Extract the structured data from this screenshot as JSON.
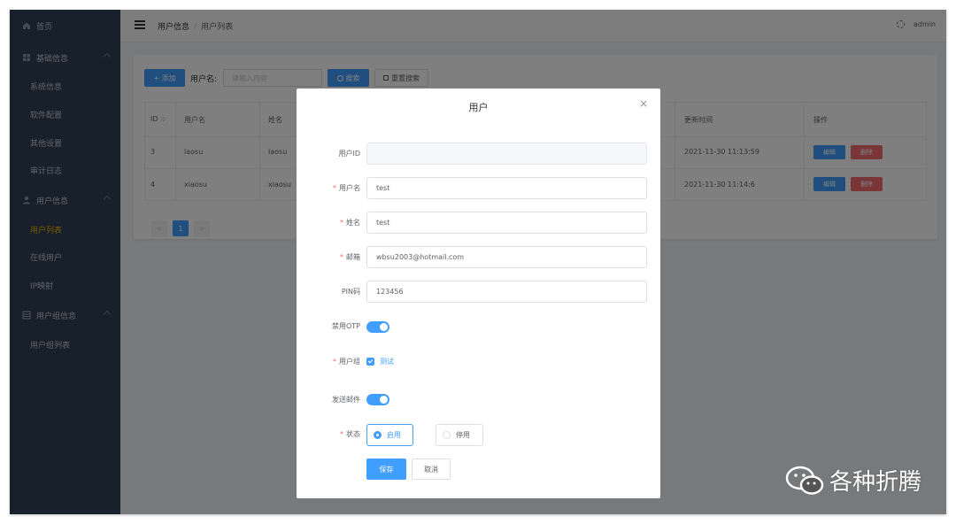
{
  "sidebar": {
    "items": [
      {
        "label": "首页",
        "level": "top",
        "icon": "home-icon"
      },
      {
        "label": "基础信息",
        "level": "top",
        "icon": "grid-icon",
        "expandable": true
      },
      {
        "label": "系统信息",
        "level": "sub"
      },
      {
        "label": "软件配置",
        "level": "sub"
      },
      {
        "label": "其他设置",
        "level": "sub"
      },
      {
        "label": "审计日志",
        "level": "sub"
      },
      {
        "label": "用户信息",
        "level": "top",
        "icon": "user-icon",
        "expandable": true
      },
      {
        "label": "用户列表",
        "level": "sub",
        "active": true
      },
      {
        "label": "在线用户",
        "level": "sub"
      },
      {
        "label": "IP映射",
        "level": "sub"
      },
      {
        "label": "用户组信息",
        "level": "top",
        "icon": "group-icon",
        "expandable": true
      },
      {
        "label": "用户组列表",
        "level": "sub"
      }
    ]
  },
  "navbar": {
    "breadcrumb": [
      "用户信息",
      "用户列表"
    ],
    "user": "admin"
  },
  "toolbar": {
    "add_label": "+ 添加",
    "filter_label": "用户名:",
    "filter_placeholder": "请输入内容",
    "search_label": "搜索",
    "reset_label": "重置搜索"
  },
  "table": {
    "headers": {
      "id": "ID",
      "username": "用户名",
      "name": "姓名",
      "updated": "更新时间",
      "ops": "操作"
    },
    "rows": [
      {
        "id": "3",
        "username": "laosu",
        "name": "laosu",
        "updated": "2021-11-30 11:13:59"
      },
      {
        "id": "4",
        "username": "xiaosu",
        "name": "xiaosu",
        "updated": "2021-11-30 11:14:6"
      }
    ],
    "edit_label": "编辑",
    "delete_label": "删除"
  },
  "pagination": {
    "current": "1",
    "prev": "<",
    "next": ">"
  },
  "dialog": {
    "title": "用户",
    "close": "×",
    "fields": {
      "user_id": {
        "label": "用户ID",
        "value": ""
      },
      "username": {
        "label": "用户名",
        "value": "test",
        "required": true
      },
      "name": {
        "label": "姓名",
        "value": "test",
        "required": true
      },
      "email": {
        "label": "邮箱",
        "value": "wbsu2003@hotmail.com",
        "required": true
      },
      "pin": {
        "label": "PIN码",
        "value": "123456"
      },
      "disable_otp": {
        "label": "禁用OTP",
        "on": true
      },
      "group": {
        "label": "用户组",
        "option": "测试",
        "checked": true,
        "required": true
      },
      "send_mail": {
        "label": "发送邮件",
        "on": true
      },
      "status": {
        "label": "状态",
        "enabled": "启用",
        "disabled": "停用",
        "selected": "启用",
        "required": true
      }
    },
    "save_label": "保存",
    "cancel_label": "取消"
  },
  "watermark": {
    "text": "各种折腾"
  },
  "colors": {
    "primary": "#409eff",
    "danger": "#f56c6c",
    "sidebar": "#304156",
    "active_menu": "#f4b400"
  }
}
